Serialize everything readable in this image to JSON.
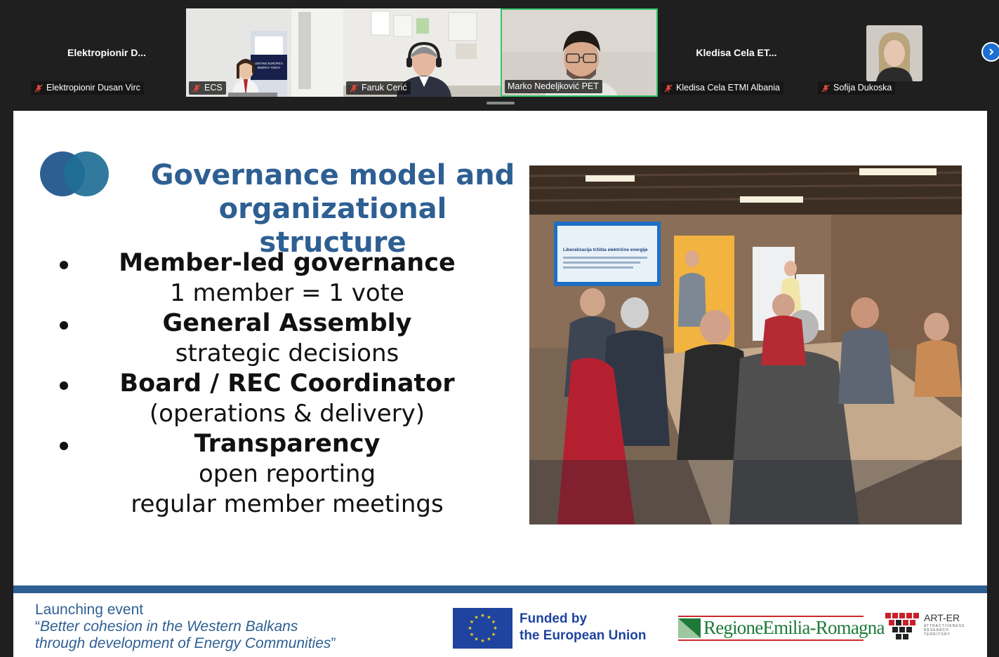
{
  "participants": [
    {
      "display": "Elektropionir  D...",
      "tag": "Elektropionir Dusan Virc",
      "video": false,
      "muted": true
    },
    {
      "display": "",
      "tag": "ECS",
      "video": true,
      "muted": true
    },
    {
      "display": "",
      "tag": "Faruk Cerić",
      "video": true,
      "muted": true
    },
    {
      "display": "",
      "tag": "Marko Nedeljković PET",
      "video": true,
      "muted": false,
      "active": true
    },
    {
      "display": "Kledisa Cela   ET...",
      "tag": "Kledisa Cela  ETMI Albania",
      "video": false,
      "muted": true
    },
    {
      "display": "",
      "tag": "Sofija Dukoska",
      "video": false,
      "muted": true,
      "avatar": true
    }
  ],
  "video_banner": {
    "line1": "UNITING EUROPE'S",
    "line2": "ENERGY TODAY"
  },
  "slide": {
    "title": "Governance model and organizational structure",
    "bullets": [
      {
        "head": "Member-led governance",
        "subs": [
          "1 member = 1 vote"
        ]
      },
      {
        "head": "General Assembly",
        "subs": [
          "strategic decisions"
        ]
      },
      {
        "head": "Board / REC Coordinator",
        "subs": [
          "(operations & delivery)"
        ]
      },
      {
        "head": "Transparency",
        "subs": [
          "open reporting",
          "regular member meetings"
        ]
      }
    ],
    "photo_screen_title": "Liberalizacija tržišta električne energije",
    "footer": {
      "line1": "Launching event",
      "quote_open": "“",
      "line2": "Better cohesion in the Western Balkans",
      "line3": "through development of Energy Communities",
      "quote_close": "”"
    },
    "eu_label_1": "Funded by",
    "eu_label_2": "the European Union",
    "regione_label": "RegioneEmilia-Romagna",
    "arter_label": "ART-ER",
    "arter_sub": "ATTRACTIVENESS RESEARCH TERRITORY"
  },
  "colors": {
    "accent": "#2e5f93",
    "active_border": "#35c46a",
    "eu_blue": "#1f44a0",
    "muted_red": "#e0443a"
  },
  "icons": {
    "mic": "mic-off-icon",
    "next": "chevron-right-icon"
  }
}
